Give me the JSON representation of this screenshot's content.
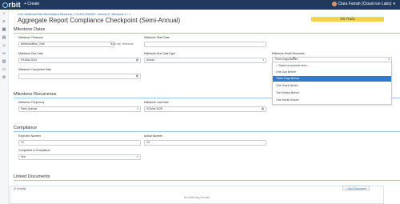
{
  "topbar": {
    "logo": "rbit",
    "create_label": "+ Create",
    "user_name": "Clara Farrah (Cloud-run Labs)"
  },
  "sidebar": {
    "icons": [
      "home-icon",
      "list-icon",
      "calendar-icon",
      "document-icon",
      "people-icon",
      "link-icon",
      "chart-icon",
      "chat-icon",
      "settings-icon"
    ]
  },
  "header": {
    "breadcrumb": "Core Additional Risk Minimization Measures / CS-A00-0000MC / Activity 5 / Milestone 3  > >",
    "title": "Aggregate Report Compliance Checkpoint (Semi-Annual)",
    "status": "On Track"
  },
  "sections": {
    "milestone_dates": "Milestone Dates",
    "milestone_recurrence": "Milestone Recurrence",
    "compliance": "Compliance",
    "linked_documents": "Linked Documents"
  },
  "fields": {
    "timezone": {
      "label": "Milestone Timezone",
      "value": "America/New_York",
      "hint": "Use My Timezone"
    },
    "start_date": {
      "label": "Milestone Start Date",
      "value": ""
    },
    "due_date": {
      "label": "Milestone Due Date",
      "value": "29-Mar-2024"
    },
    "due_date_type": {
      "label": "Milestone Due Date Type",
      "value": "Actual"
    },
    "email_reminder": {
      "label": "Milestone Email Reminder",
      "value": "Three Days Before"
    },
    "completed_date": {
      "label": "Milestone Completed Date",
      "value": ""
    },
    "frequency": {
      "label": "Milestone Frequency",
      "value": "Semi-Annual"
    },
    "last_date": {
      "label": "Milestone Last Date",
      "value": "03-Mar-2026"
    },
    "expected_number": {
      "label": "Expected Number",
      "value": "10"
    },
    "actual_number": {
      "label": "Actual Number",
      "value": "10"
    },
    "completed_in_compliance": {
      "label": "Completed in Compliance",
      "value": "Yes"
    }
  },
  "reminder_dropdown": {
    "options": [
      "-- Select a reminder time --",
      "One Day Before",
      "Three Days Before",
      "One Week Before",
      "Two Weeks Before",
      "One Month Before"
    ],
    "selected": "Three Days Before"
  },
  "documents": {
    "results": "(0 results)",
    "add_label": "+ Add Document",
    "empty_text": "No Matching Results"
  }
}
